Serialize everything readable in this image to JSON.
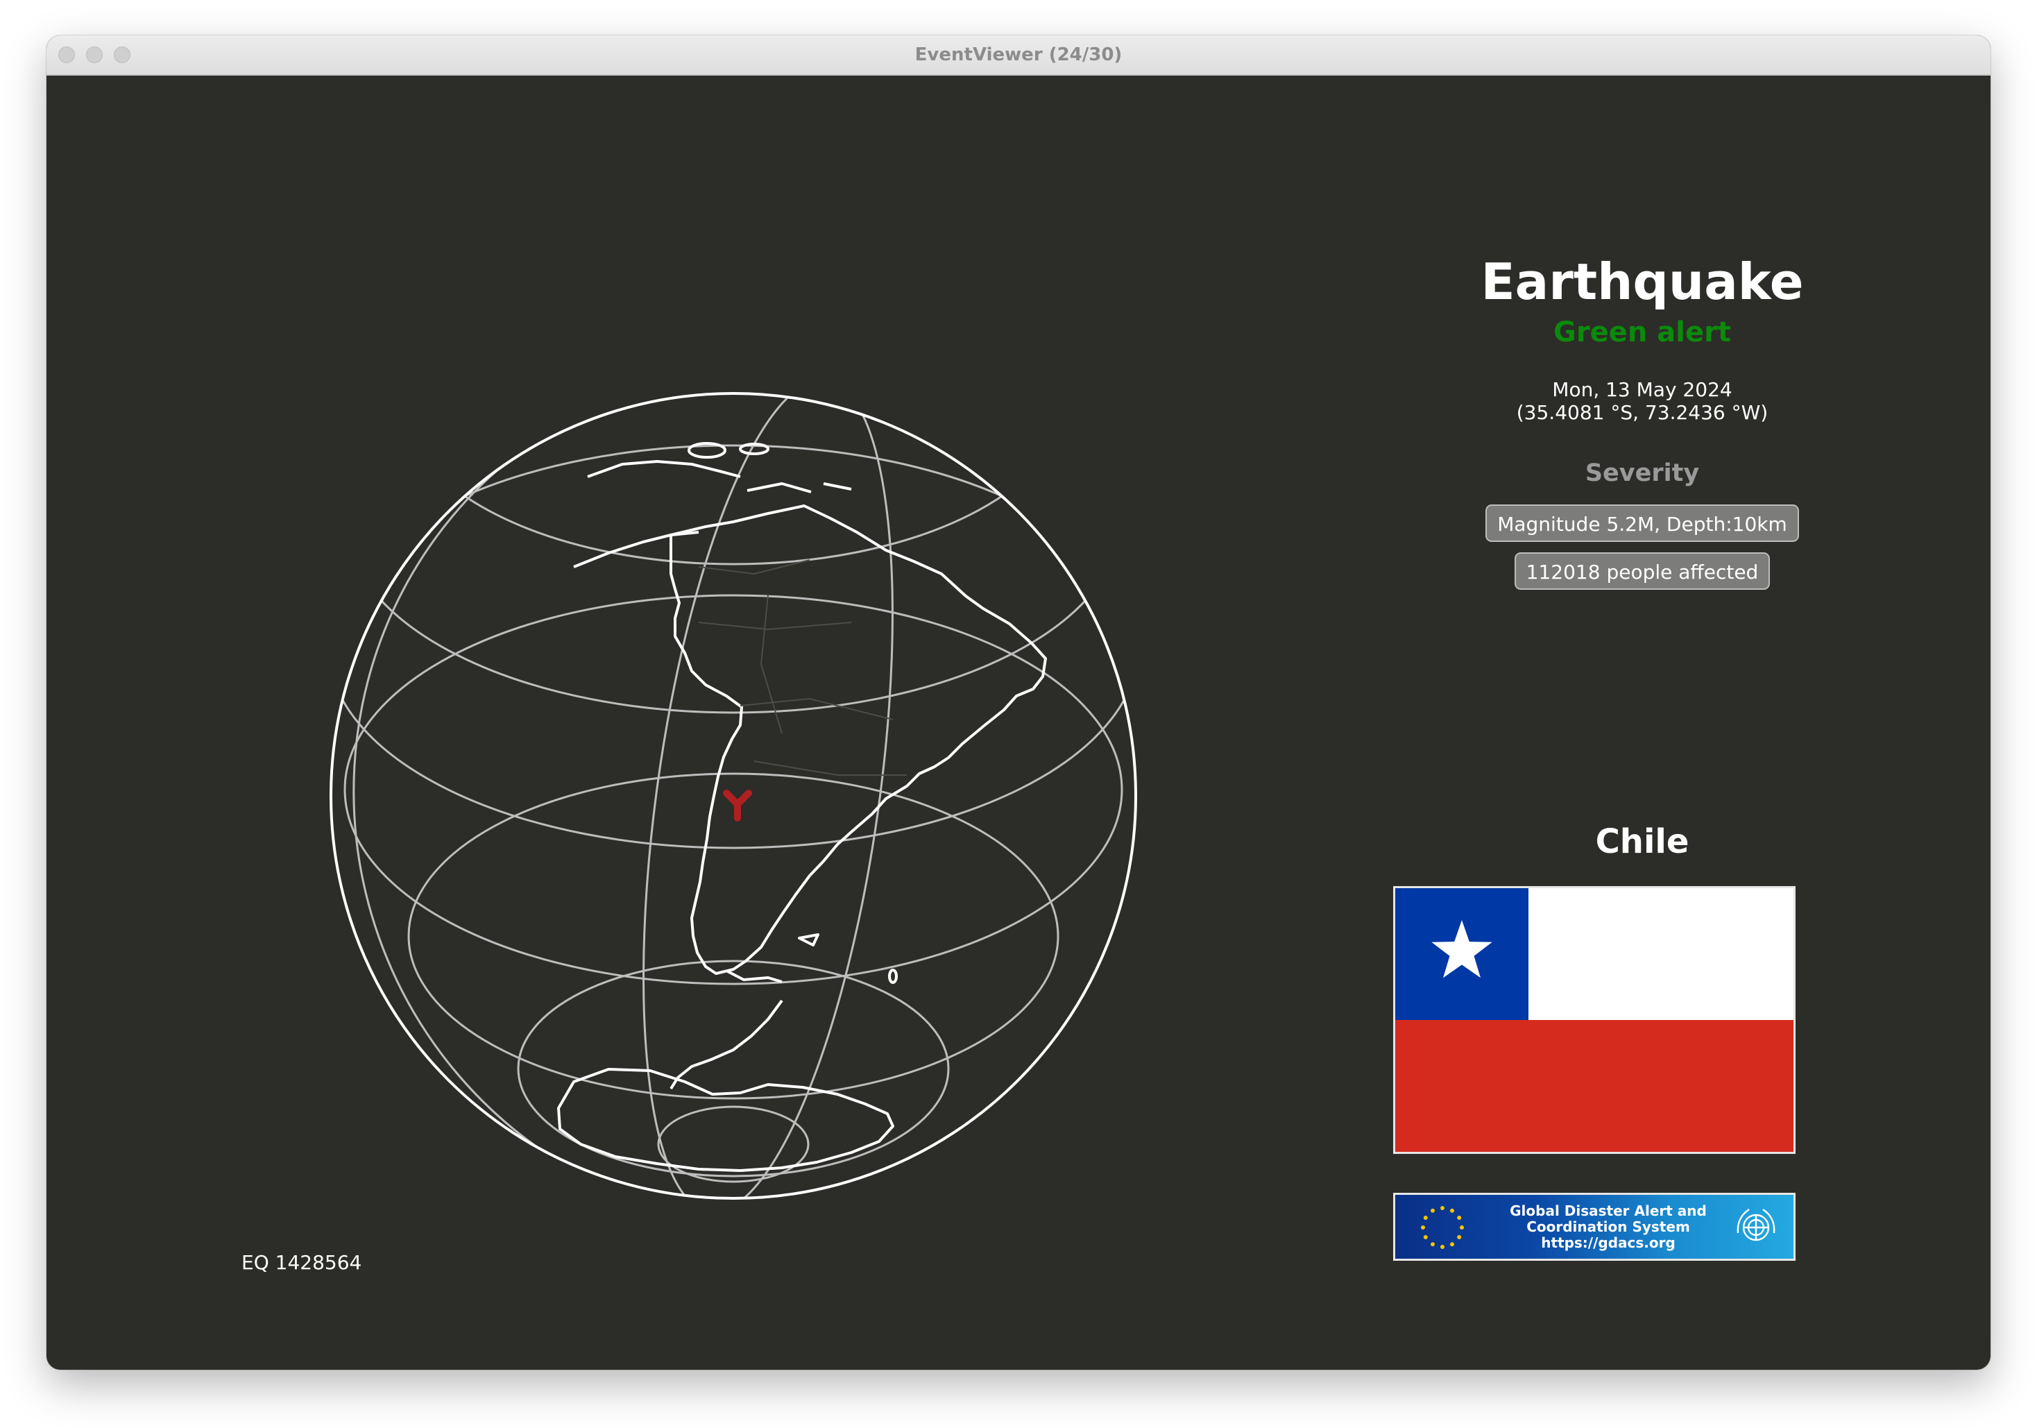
{
  "window": {
    "title": "EventViewer (24/30)"
  },
  "event": {
    "id": "EQ 1428564",
    "type": "Earthquake",
    "alert": "Green alert",
    "date": "Mon, 13 May 2024",
    "coordinates": "(35.4081 °S, 73.2436 °W)"
  },
  "severity": {
    "heading": "Severity",
    "magnitude": "Magnitude 5.2M, Depth:10km",
    "affected": "112018 people affected"
  },
  "location": {
    "country": "Chile"
  },
  "logo": {
    "line1": "Global Disaster Alert and",
    "line2": "Coordination System",
    "line3": "https://gdacs.org"
  },
  "colors": {
    "background": "#2c2c28",
    "alert_green": "#0b8a0b",
    "marker_red": "#b02020",
    "flag_blue": "#0039a6",
    "flag_red": "#d52b1e"
  },
  "icons": {
    "marker": "earthquake-marker-icon",
    "eu": "eu-stars-icon",
    "un": "un-emblem-icon"
  }
}
